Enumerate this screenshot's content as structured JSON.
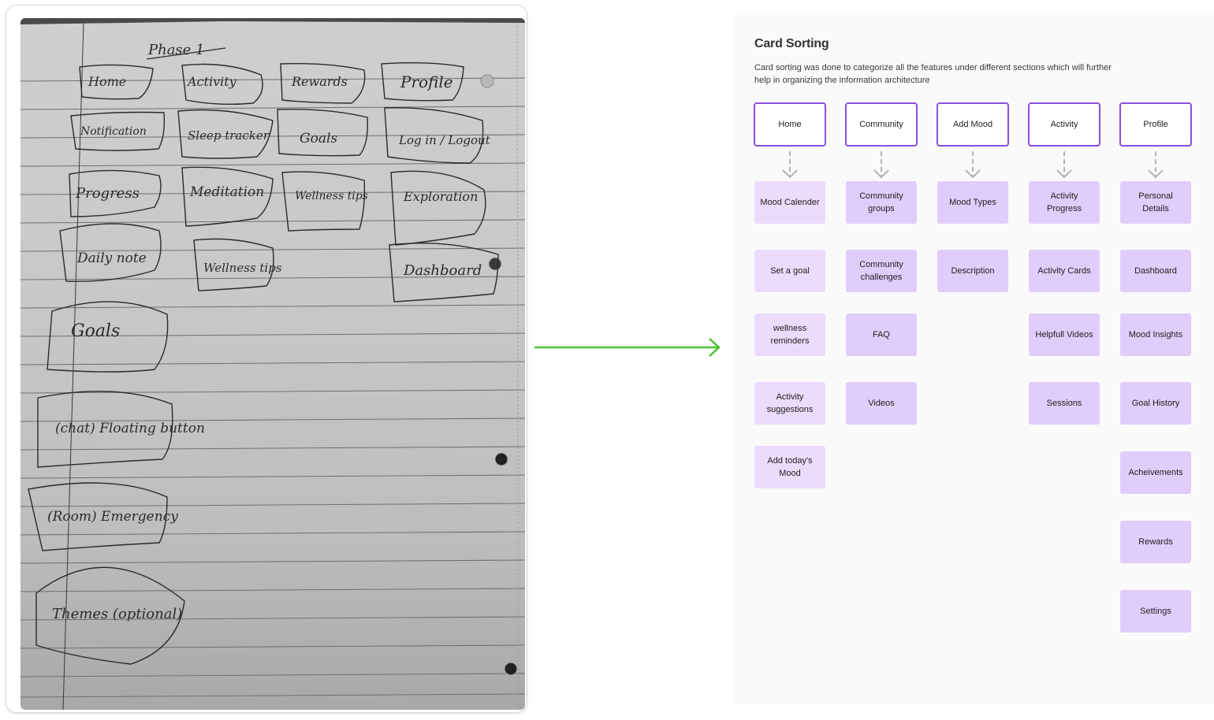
{
  "sketch": {
    "title": "Phase 1",
    "notes": [
      "Home",
      "Activity",
      "Rewards",
      "Profile",
      "Notification",
      "Sleep tracker",
      "Goals",
      "Log in / Logout",
      "Progress",
      "Meditation",
      "Wellness tips",
      "Exploration",
      "Daily note",
      "Wellness tips",
      "Dashboard",
      "Goals",
      "(chat) Floating button",
      "(Room) Emergency",
      "Themes (optional)"
    ]
  },
  "panel": {
    "title": "Card Sorting",
    "description": "Card sorting was done to categorize all the features under different sections which will further help in organizing the information architecture",
    "colors": {
      "header_border": "#8a4fdc",
      "card_fill": "#e1cdfb",
      "card_fill_light": "#ebdcfb",
      "connector_arrow": "#22bb22"
    },
    "columns": [
      {
        "header": "Home",
        "cards": [
          "Mood Calender",
          "Set a goal",
          "wellness reminders",
          "Activity suggestions",
          "Add today's Mood"
        ]
      },
      {
        "header": "Community",
        "cards": [
          "Community groups",
          "Community challenges",
          "FAQ",
          "Videos"
        ]
      },
      {
        "header": "Add Mood",
        "cards": [
          "Mood Types",
          "Description"
        ]
      },
      {
        "header": "Activity",
        "cards": [
          "Activity Progress",
          "Activity Cards",
          "Helpfull Videos",
          "Sessions"
        ]
      },
      {
        "header": "Profile",
        "cards": [
          "Personal Details",
          "Dashboard",
          "Mood Insights",
          "Goal History",
          "Acheivements",
          "Rewards",
          "Settings"
        ]
      }
    ]
  }
}
